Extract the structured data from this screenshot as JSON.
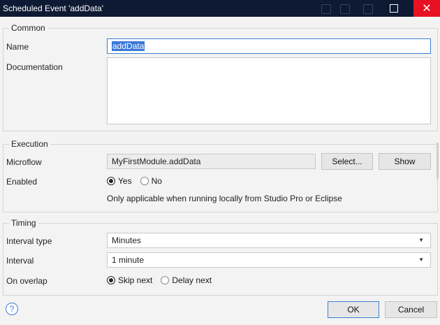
{
  "window": {
    "title": "Scheduled Event 'addData'"
  },
  "common": {
    "title": "Common",
    "name_label": "Name",
    "name_value": "addData",
    "documentation_label": "Documentation",
    "documentation_value": ""
  },
  "execution": {
    "title": "Execution",
    "microflow_label": "Microflow",
    "microflow_value": "MyFirstModule.addData",
    "select_label": "Select...",
    "show_label": "Show",
    "enabled_label": "Enabled",
    "enabled_options": [
      "Yes",
      "No"
    ],
    "enabled_selected": "Yes",
    "note": "Only applicable when running locally from Studio Pro or Eclipse"
  },
  "timing": {
    "title": "Timing",
    "interval_type_label": "Interval type",
    "interval_type_value": "Minutes",
    "interval_label": "Interval",
    "interval_value": "1 minute",
    "on_overlap_label": "On overlap",
    "overlap_options": [
      "Skip next",
      "Delay next"
    ],
    "overlap_selected": "Skip next"
  },
  "footer": {
    "help_icon": "question-circle-icon",
    "help_glyph": "?",
    "ok_label": "OK",
    "cancel_label": "Cancel"
  },
  "colors": {
    "titlebar": "#0e1a33",
    "close": "#e81123",
    "accent": "#3c7fd4",
    "selection": "#3b78d8"
  }
}
